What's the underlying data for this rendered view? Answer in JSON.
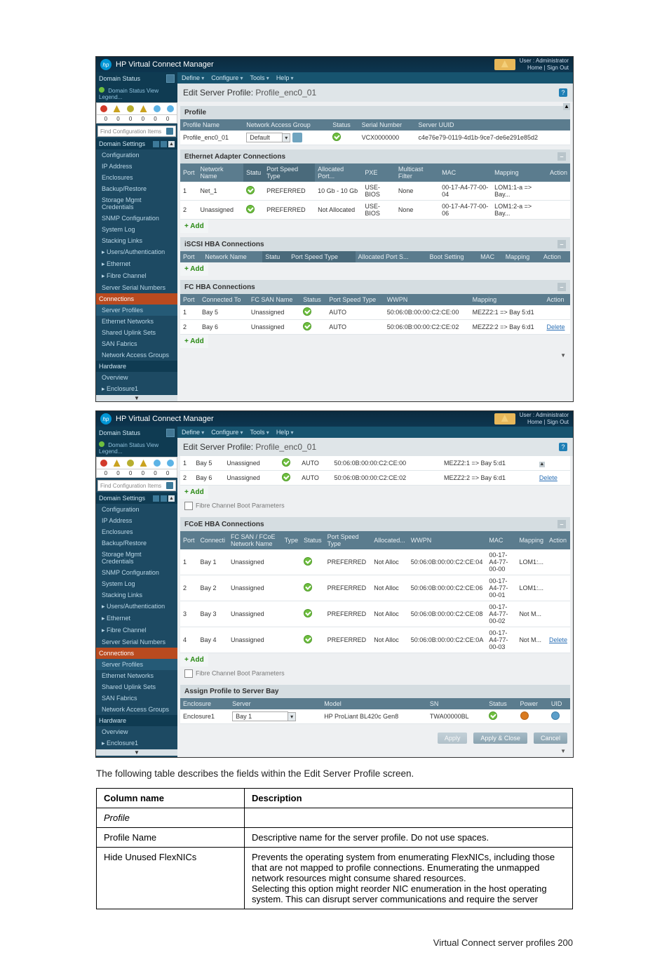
{
  "app_title": "HP Virtual Connect Manager",
  "user_label": "User : Administrator",
  "user_links": "Home | Sign Out",
  "menus": [
    "Define",
    "Configure",
    "Tools",
    "Help"
  ],
  "page_heading_prefix": "Edit Server Profile:",
  "page_heading_name": "Profile_enc0_01",
  "sidebar": {
    "domain_status_hdr": "Domain Status",
    "domain_links": "Domain Status    View Legend...",
    "icon_colors": [
      "#d23a2a",
      "#caa21f",
      "#b7ae2f",
      "#caa21f",
      "#5cb3e6",
      "#5cb3e6"
    ],
    "icon_counts": [
      "0",
      "0",
      "0",
      "0",
      "0",
      "0"
    ],
    "search_placeholder": "Find Configuration Items",
    "domain_settings": "Domain Settings",
    "ds_items": [
      "Configuration",
      "IP Address",
      "Enclosures",
      "Backup/Restore",
      "Storage Mgmt Credentials",
      "SNMP Configuration",
      "System Log",
      "Stacking Links"
    ],
    "ua": "Users/Authentication",
    "eth": "Ethernet",
    "fc": "Fibre Channel",
    "ssn": "Server Serial Numbers",
    "connections": "Connections",
    "conn_items": [
      "Server Profiles",
      "Ethernet Networks",
      "Shared Uplink Sets",
      "SAN Fabrics",
      "Network Access Groups"
    ],
    "hardware": "Hardware",
    "hw_items": [
      "Overview",
      "Enclosure1"
    ]
  },
  "profile_panel": {
    "title": "Profile",
    "cols": [
      "Profile Name",
      "Network Access Group",
      "Status",
      "Serial Number",
      "Server UUID"
    ],
    "row": {
      "name": "Profile_enc0_01",
      "nag": "Default",
      "serial": "VCX0000000",
      "uuid": "c4e76e79-0119-4d1b-9ce7-de6e291e85d2"
    }
  },
  "eth_panel": {
    "title": "Ethernet Adapter Connections",
    "cols": [
      "Port",
      "Network Name",
      "Statu",
      "Port Speed Type",
      "Allocated Port...",
      "PXE",
      "Multicast Filter",
      "MAC",
      "Mapping",
      "Action"
    ],
    "rows": [
      {
        "port": "1",
        "net": "Net_1",
        "spd": "PREFERRED",
        "alloc": "10 Gb - 10 Gb",
        "pxe": "USE-BIOS",
        "mf": "None",
        "mac": "00-17-A4-77-00-04",
        "map": "LOM1:1-a => Bay..."
      },
      {
        "port": "2",
        "net": "Unassigned",
        "spd": "PREFERRED",
        "alloc": "Not Allocated",
        "pxe": "USE-BIOS",
        "mf": "None",
        "mac": "00-17-A4-77-00-06",
        "map": "LOM1:2-a => Bay..."
      }
    ],
    "add": "Add"
  },
  "iscsi_panel": {
    "title": "iSCSI HBA Connections",
    "cols": [
      "Port",
      "Network Name",
      "Statu",
      "Port Speed Type",
      "Allocated Port S...",
      "Boot Setting",
      "MAC",
      "Mapping",
      "Action"
    ],
    "add": "Add"
  },
  "fc_panel": {
    "title": "FC HBA Connections",
    "cols": [
      "Port",
      "Connected To",
      "FC SAN Name",
      "Status",
      "Port Speed Type",
      "WWPN",
      "Mapping",
      "Action"
    ],
    "rows": [
      {
        "port": "1",
        "bay": "Bay 5",
        "san": "Unassigned",
        "spd": "AUTO",
        "wwpn": "50:06:0B:00:00:C2:CE:00",
        "map": "MEZZ2:1 => Bay 5:d1"
      },
      {
        "port": "2",
        "bay": "Bay 6",
        "san": "Unassigned",
        "spd": "AUTO",
        "wwpn": "50:06:0B:00:00:C2:CE:02",
        "map": "MEZZ2:2 => Bay 6:d1"
      }
    ],
    "delete": "Delete"
  },
  "fc_panel2": {
    "add": "Add",
    "chk_label": "Fibre Channel Boot Parameters"
  },
  "fcoe_panel": {
    "title": "FCoE HBA Connections",
    "cols": [
      "Port",
      "Connecti",
      "FC SAN / FCoE Network Name",
      "Type",
      "Status",
      "Port Speed Type",
      "Allocated...",
      "WWPN",
      "MAC",
      "Mapping",
      "Action"
    ],
    "rows": [
      {
        "port": "1",
        "bay": "Bay 1",
        "san": "Unassigned",
        "spd": "PREFERRED",
        "alloc": "Not Alloc",
        "wwpn": "50:06:0B:00:00:C2:CE:04",
        "mac": "00-17-A4-77-00-00",
        "map": "LOM1:..."
      },
      {
        "port": "2",
        "bay": "Bay 2",
        "san": "Unassigned",
        "spd": "PREFERRED",
        "alloc": "Not Alloc",
        "wwpn": "50:06:0B:00:00:C2:CE:06",
        "mac": "00-17-A4-77-00-01",
        "map": "LOM1:..."
      },
      {
        "port": "3",
        "bay": "Bay 3",
        "san": "Unassigned",
        "spd": "PREFERRED",
        "alloc": "Not Alloc",
        "wwpn": "50:06:0B:00:00:C2:CE:08",
        "mac": "00-17-A4-77-00-02",
        "map": "Not M..."
      },
      {
        "port": "4",
        "bay": "Bay 4",
        "san": "Unassigned",
        "spd": "PREFERRED",
        "alloc": "Not Alloc",
        "wwpn": "50:06:0B:00:00:C2:CE:0A",
        "mac": "00-17-A4-77-00-03",
        "map": "Not M..."
      }
    ],
    "add": "Add",
    "chk_label": "Fibre Channel Boot Parameters",
    "delete": "Delete"
  },
  "assign_panel": {
    "title": "Assign Profile to Server Bay",
    "cols": [
      "Enclosure",
      "Server",
      "Model",
      "SN",
      "Status",
      "Power",
      "UID"
    ],
    "row": {
      "enc": "Enclosure1",
      "server": "Bay 1",
      "model": "HP ProLiant BL420c Gen8",
      "sn": "TWA00000BL"
    }
  },
  "buttons": {
    "apply": "Apply",
    "apply_close": "Apply & Close",
    "cancel": "Cancel"
  },
  "doc": {
    "intro": "The following table describes the fields within the Edit Server Profile screen.",
    "th1": "Column name",
    "th2": "Description",
    "r1c1": "Profile",
    "r2c1": "Profile Name",
    "r2c2": "Descriptive name for the server profile. Do not use spaces.",
    "r3c1": "Hide Unused FlexNICs",
    "r3c2": "Prevents the operating system from enumerating FlexNICs, including those that are not mapped to profile connections. Enumerating the unmapped network resources might consume shared resources.\nSelecting this option might reorder NIC enumeration in the host operating system. This can disrupt server communications and require the server",
    "footer": "Virtual Connect server profiles    200"
  }
}
